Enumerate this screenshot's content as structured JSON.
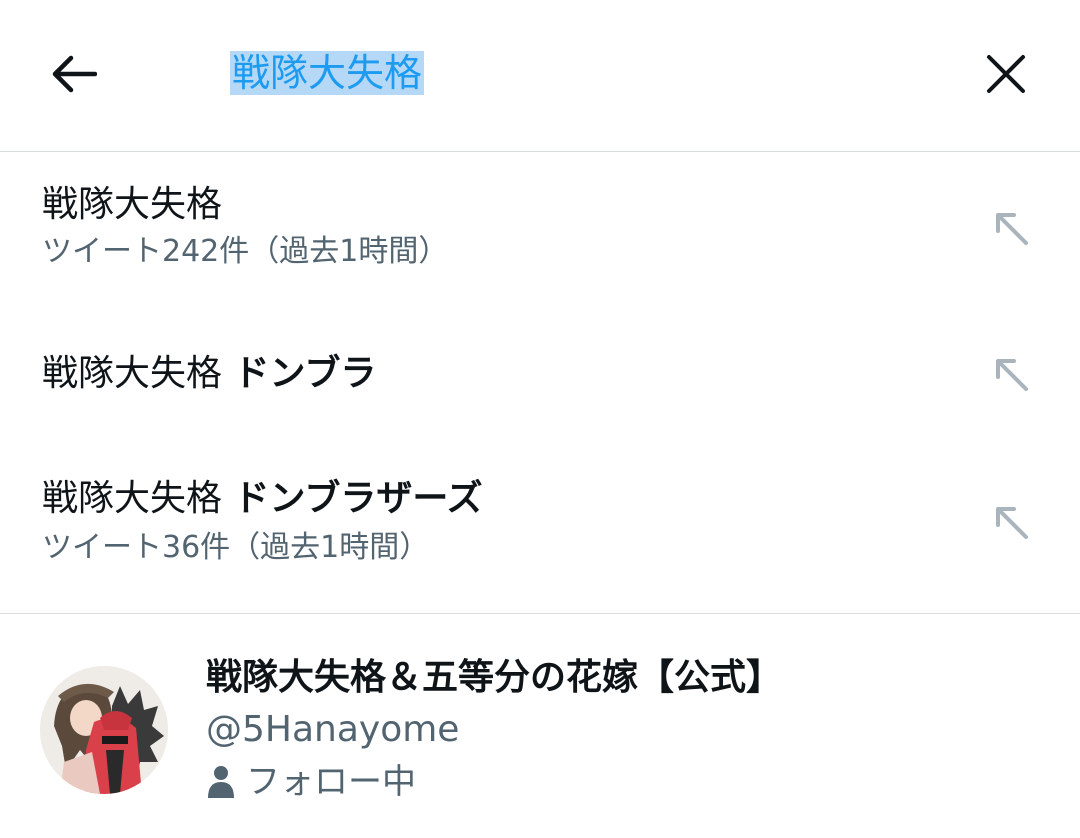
{
  "header": {
    "back_icon": "arrow-left-icon",
    "search_value": "戦隊大失格",
    "close_icon": "close-x-icon"
  },
  "suggestions": [
    {
      "query": "戦隊大失格",
      "bold": "",
      "sub": "ツイート242件（過去1時間）"
    },
    {
      "query": "戦隊大失格",
      "bold": "ドンブラ",
      "sub": ""
    },
    {
      "query": "戦隊大失格",
      "bold": "ドンブラザーズ",
      "sub": "ツイート36件（過去1時間）"
    }
  ],
  "account": {
    "name": "戦隊大失格＆五等分の花嫁【公式】",
    "handle": "@5Hanayome",
    "status": "フォロー中",
    "status_icon": "person-icon"
  },
  "colors": {
    "accent": "#1d9bf0",
    "selection": "#b5d8f6",
    "secondary_text": "#536471",
    "divider": "#dadde0"
  }
}
